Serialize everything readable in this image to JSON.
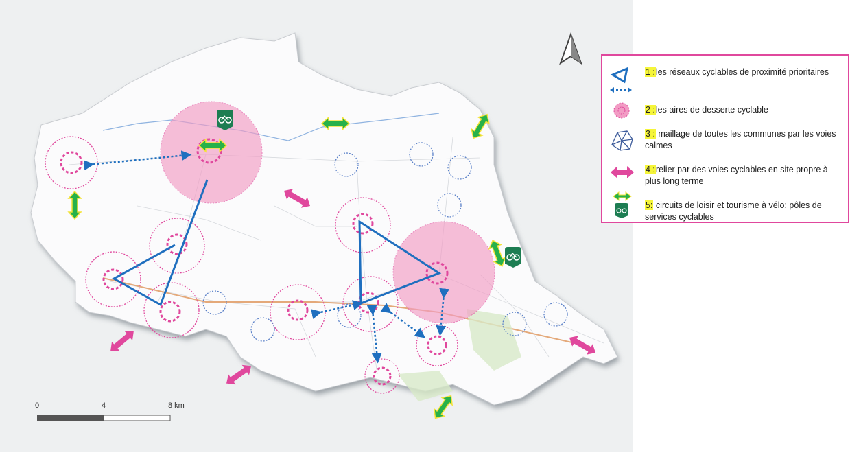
{
  "legend": {
    "items": [
      {
        "num": "1 :",
        "text": "les réseaux cyclables de proximité prioritaires"
      },
      {
        "num": "2 :",
        "text": "les aires de desserte cyclable"
      },
      {
        "num": "3 :",
        "text": " maillage de toutes les communes par les voies calmes"
      },
      {
        "num": "4 :",
        "text": "relier par des voies cyclables en site propre à plus long terme"
      },
      {
        "num": "5:",
        "text": " circuits de loisir et tourisme à vélo; pôles de services cyclables"
      }
    ]
  },
  "scale": {
    "labels": [
      "0",
      "4",
      "8 km"
    ]
  },
  "colors": {
    "blue": "#1f6fbf",
    "pink": "#e0489d",
    "green": "#27b14a",
    "navy": "#3b5a9a",
    "yellow": "#f5f53a"
  },
  "icons": [
    "north-arrow-icon",
    "bike-service-icon",
    "triangle-network-icon",
    "dotted-circle-icon",
    "mesh-icon",
    "double-arrow-icon"
  ]
}
